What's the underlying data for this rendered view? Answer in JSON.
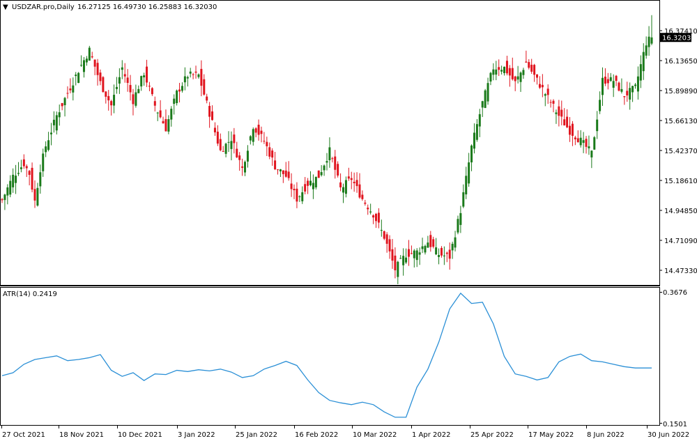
{
  "main_panel": {
    "header_arrow": "▼",
    "symbol": "USDZAR.pro,Daily",
    "ohlc_text": "16.27125 16.49730 16.25883 16.32030",
    "current_price": "16.32030"
  },
  "atr_panel": {
    "label": "ATR(14) 0.2419",
    "tick_labels": [
      "0.3676",
      "0.1501"
    ]
  },
  "colors": {
    "bull": "#1a7a1a",
    "bear": "#e0141e",
    "atr_line": "#2a8fd6",
    "frame": "#000000",
    "price_label_bg": "#000000",
    "price_label_text": "#ffffff"
  },
  "chart_data": [
    {
      "type": "candlestick",
      "title": "USDZAR.pro,Daily",
      "ylim": [
        14.35,
        16.55
      ],
      "y_ticks": [
        "16.37410",
        "16.13650",
        "15.89890",
        "15.66130",
        "15.42370",
        "15.18610",
        "14.94850",
        "14.71090",
        "14.47330"
      ],
      "x_ticks": [
        "27 Oct 2021",
        "18 Nov 2021",
        "10 Dec 2021",
        "3 Jan 2022",
        "25 Jan 2022",
        "16 Feb 2022",
        "10 Mar 2022",
        "1 Apr 2022",
        "25 Apr 2022",
        "17 May 2022",
        "8 Jun 2022",
        "30 Jun 2022"
      ],
      "close_path": [
        [
          0,
          15.03
        ],
        [
          4,
          15.22
        ],
        [
          8,
          15.32
        ],
        [
          10,
          15.24
        ],
        [
          12,
          15.02
        ],
        [
          14,
          15.28
        ],
        [
          16,
          15.46
        ],
        [
          20,
          15.7
        ],
        [
          24,
          15.88
        ],
        [
          28,
          16.06
        ],
        [
          32,
          16.22
        ],
        [
          36,
          15.96
        ],
        [
          40,
          15.78
        ],
        [
          44,
          16.08
        ],
        [
          48,
          15.82
        ],
        [
          52,
          16.04
        ],
        [
          56,
          15.78
        ],
        [
          60,
          15.6
        ],
        [
          64,
          15.88
        ],
        [
          68,
          16.02
        ],
        [
          72,
          16.02
        ],
        [
          76,
          15.72
        ],
        [
          80,
          15.42
        ],
        [
          84,
          15.52
        ],
        [
          88,
          15.28
        ],
        [
          92,
          15.62
        ],
        [
          96,
          15.5
        ],
        [
          100,
          15.3
        ],
        [
          104,
          15.22
        ],
        [
          108,
          15.04
        ],
        [
          112,
          15.16
        ],
        [
          116,
          15.22
        ],
        [
          120,
          15.42
        ],
        [
          124,
          15.12
        ],
        [
          128,
          15.2
        ],
        [
          132,
          15.04
        ],
        [
          136,
          14.92
        ],
        [
          140,
          14.74
        ],
        [
          144,
          14.48
        ],
        [
          148,
          14.6
        ],
        [
          152,
          14.62
        ],
        [
          156,
          14.7
        ],
        [
          160,
          14.6
        ],
        [
          164,
          14.58
        ],
        [
          168,
          14.95
        ],
        [
          172,
          15.45
        ],
        [
          176,
          15.8
        ],
        [
          180,
          16.08
        ],
        [
          184,
          16.08
        ],
        [
          188,
          15.96
        ],
        [
          192,
          16.12
        ],
        [
          196,
          15.98
        ],
        [
          200,
          15.84
        ],
        [
          204,
          15.7
        ],
        [
          208,
          15.58
        ],
        [
          212,
          15.5
        ],
        [
          216,
          15.4
        ],
        [
          220,
          15.98
        ],
        [
          224,
          15.98
        ],
        [
          228,
          15.86
        ],
        [
          232,
          15.92
        ],
        [
          236,
          16.28
        ],
        [
          238,
          16.32
        ]
      ],
      "last_ohlc": {
        "open": 16.27125,
        "high": 16.4973,
        "low": 16.25883,
        "close": 16.3203
      }
    },
    {
      "type": "line",
      "title": "ATR(14)",
      "ylim": [
        0.1501,
        0.3676
      ],
      "last_value": 0.2419,
      "x": [
        0,
        4,
        8,
        12,
        16,
        20,
        24,
        28,
        32,
        36,
        40,
        44,
        48,
        52,
        56,
        60,
        64,
        68,
        72,
        76,
        80,
        84,
        88,
        92,
        96,
        100,
        104,
        108,
        112,
        116,
        120,
        124,
        128,
        132,
        136,
        140,
        144,
        148,
        152,
        156,
        160,
        164,
        168,
        172,
        176,
        180,
        184,
        188,
        192,
        196,
        200,
        204,
        208,
        212,
        216,
        220,
        224,
        228,
        232,
        236,
        238
      ],
      "values": [
        0.229,
        0.234,
        0.248,
        0.256,
        0.259,
        0.262,
        0.254,
        0.256,
        0.259,
        0.264,
        0.238,
        0.228,
        0.234,
        0.221,
        0.232,
        0.231,
        0.238,
        0.236,
        0.239,
        0.237,
        0.24,
        0.235,
        0.226,
        0.229,
        0.24,
        0.246,
        0.253,
        0.246,
        0.222,
        0.201,
        0.188,
        0.184,
        0.181,
        0.185,
        0.181,
        0.169,
        0.16,
        0.16,
        0.21,
        0.24,
        0.285,
        0.34,
        0.366,
        0.349,
        0.351,
        0.315,
        0.261,
        0.232,
        0.228,
        0.222,
        0.226,
        0.252,
        0.261,
        0.265,
        0.254,
        0.252,
        0.248,
        0.244
      ]
    }
  ]
}
